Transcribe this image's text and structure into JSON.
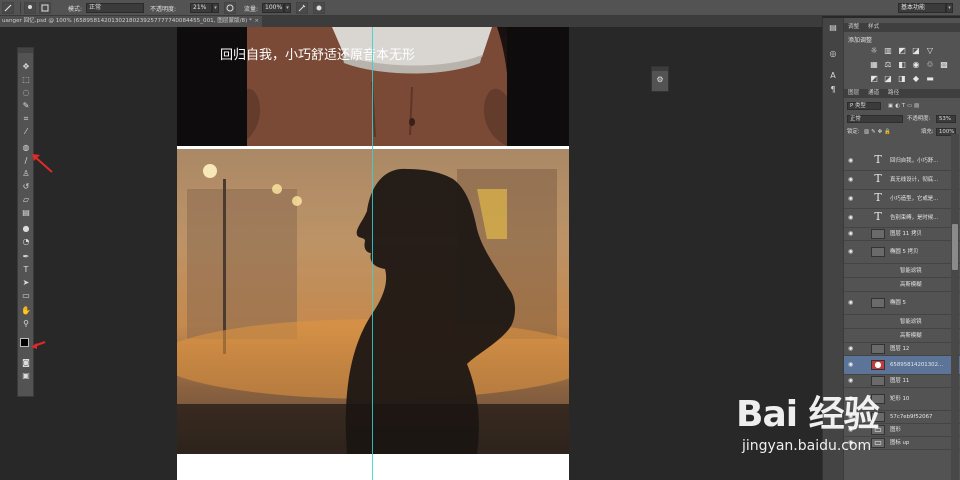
{
  "options_bar": {
    "mode_label": "模式:",
    "mode_value": "正常",
    "opacity_label": "不透明度:",
    "opacity_value": "21%",
    "flow_label": "流量:",
    "flow_value": "100%",
    "workspace": "基本功能"
  },
  "document": {
    "tab_title": "uanger 回忆.psd @ 100% (65895814201302180239257777740084455_001, 图层蒙版/8) *",
    "caption": "回归自我，小巧舒适还原音本无形"
  },
  "tools": [
    "move",
    "marquee",
    "lasso",
    "quick-select",
    "crop",
    "eyedropper",
    "healing",
    "brush",
    "clone-stamp",
    "history-brush",
    "eraser",
    "gradient",
    "blur",
    "dodge",
    "pen",
    "type",
    "path-select",
    "rectangle",
    "hand",
    "zoom"
  ],
  "right_panel": {
    "tabs": [
      "调整",
      "样式"
    ],
    "adjust_title": "添加调整",
    "layers_tabs": [
      "图层",
      "通道",
      "路径"
    ],
    "filter_label": "P 类型",
    "blend_mode": "正常",
    "opacity_label": "不透明度:",
    "opacity_value": "53%",
    "lock_label": "锁定:",
    "fill_label": "填充:",
    "fill_value": "100%"
  },
  "layers": [
    {
      "name": "回归自我，小巧舒...",
      "kind": "text"
    },
    {
      "name": "真无线设计，彻底...",
      "kind": "text"
    },
    {
      "name": "小巧造型，它或是...",
      "kind": "text"
    },
    {
      "name": "告别束缚，是时候...",
      "kind": "text"
    },
    {
      "name": "图层 11 拷贝",
      "kind": "pixel"
    },
    {
      "name": "椭圆 5 拷贝",
      "kind": "shape"
    },
    {
      "name": "智能滤镜",
      "kind": "sub"
    },
    {
      "name": "高斯模糊",
      "kind": "sub"
    },
    {
      "name": "椭圆 5",
      "kind": "shape"
    },
    {
      "name": "智能滤镜",
      "kind": "sub"
    },
    {
      "name": "高斯模糊",
      "kind": "sub"
    },
    {
      "name": "图层 12",
      "kind": "pixel"
    },
    {
      "name": "65895814201302...",
      "kind": "masked",
      "selected": true
    },
    {
      "name": "图层 11",
      "kind": "pixel"
    },
    {
      "name": "矩形 10",
      "kind": "shape"
    },
    {
      "name": "57c7eb9f52067",
      "kind": "pixel"
    },
    {
      "name": "图形",
      "kind": "group"
    },
    {
      "name": "图标 up",
      "kind": "group"
    }
  ],
  "colors": {
    "ui_bg": "#535353",
    "canvas_bg": "#282828",
    "selection": "#5b7497",
    "guide": "#33d4d4"
  },
  "watermark": {
    "logo": "Bai 经验",
    "url": "jingyan.baidu.com"
  }
}
